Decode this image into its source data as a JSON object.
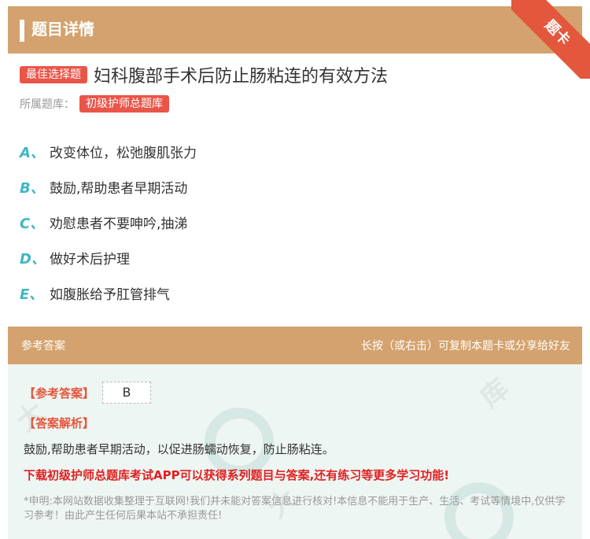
{
  "header": {
    "title": "题目详情",
    "corner_badge": "题卡"
  },
  "question": {
    "type_tag": "最佳选择题",
    "text": "妇科腹部手术后防止肠粘连的有效方法",
    "bank_label": "所属题库：",
    "bank_name": "初级护师总题库"
  },
  "options": [
    {
      "letter": "A、",
      "text": "改变体位，松弛腹肌张力"
    },
    {
      "letter": "B、",
      "text": "鼓励,帮助患者早期活动"
    },
    {
      "letter": "C、",
      "text": "劝慰患者不要呻吟,抽涕"
    },
    {
      "letter": "D、",
      "text": "做好术后护理"
    },
    {
      "letter": "E、",
      "text": "如腹胀给予肛管排气"
    }
  ],
  "answer_section": {
    "title": "参考答案",
    "hint": "长按（或右击）可复制本题卡或分享给好友",
    "ref_label": "【参考答案】",
    "ref_answer": "B",
    "expl_label": "【答案解析】",
    "expl_text": "鼓励,帮助患者早期活动，以促进肠蠕动恢复，防止肠粘连。",
    "promo": "下载初级护师总题库考试APP可以获得系列题目与答案,还有练习等更多学习功能!",
    "disclaimer": "*申明:本网站数据收集整理于互联网!我们并未能对答案信息进行核对!本信息不能用于生产、生活、考试等情境中,仅供学习参考！由此产生任何后果本站不承担责任!"
  },
  "colors": {
    "header_bg": "#d4a26e",
    "accent_red": "#ea5549",
    "option_letter": "#3fb6c3",
    "answer_bg": "#eef6f3"
  }
}
